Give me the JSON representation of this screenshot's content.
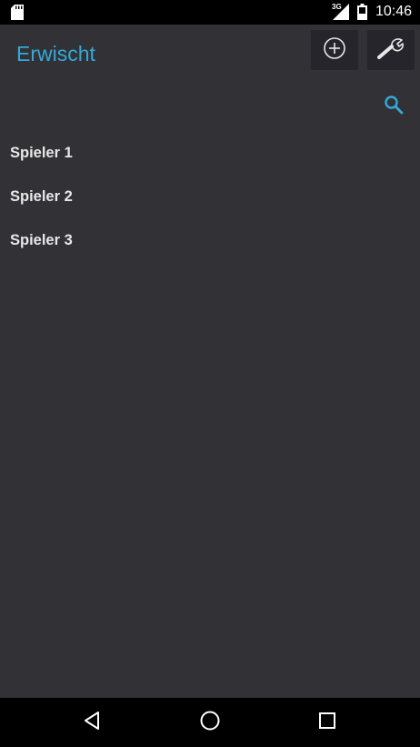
{
  "status_bar": {
    "network": "3G",
    "time": "10:46",
    "icons": [
      "sd-card-icon",
      "signal-icon",
      "battery-icon"
    ]
  },
  "action_bar": {
    "title": "Erwischt",
    "actions": [
      "add-circle-icon",
      "wrench-icon"
    ]
  },
  "search": {
    "icon": "search-icon"
  },
  "players": [
    {
      "label": "Spieler 1"
    },
    {
      "label": "Spieler 2"
    },
    {
      "label": "Spieler 3"
    }
  ],
  "nav_bar": {
    "buttons": [
      "back-icon",
      "home-icon",
      "recents-icon"
    ]
  },
  "colors": {
    "background": "#323135",
    "accent": "#33a9d9",
    "bar": "#000000",
    "button_bg": "#25252b"
  }
}
